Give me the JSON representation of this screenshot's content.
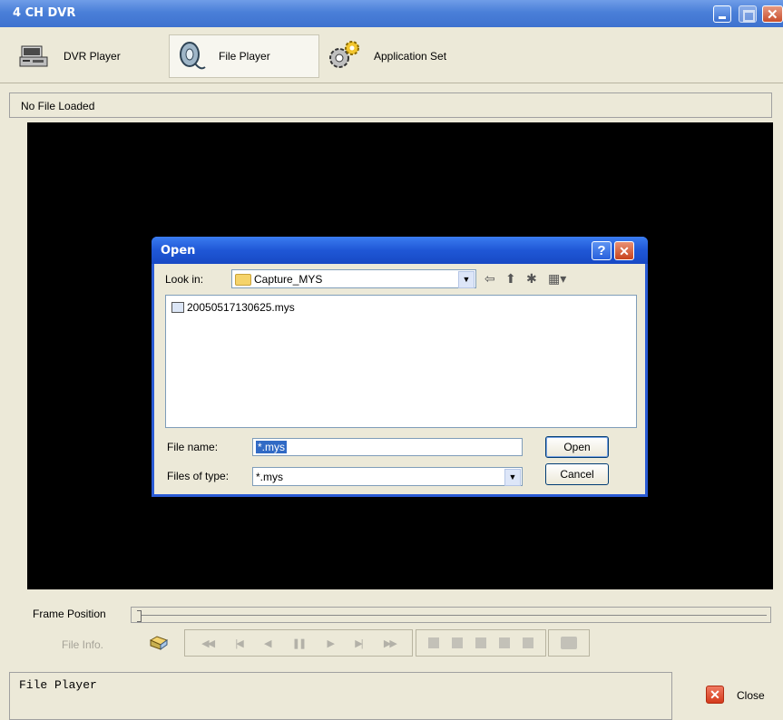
{
  "window": {
    "title": "4 CH DVR"
  },
  "toolbar": {
    "dvr_label": "DVR Player",
    "file_label": "File Player",
    "app_label": "Application Set"
  },
  "status": {
    "text": "No File Loaded"
  },
  "dialog": {
    "title": "Open",
    "help": "?",
    "look_in_label": "Look in:",
    "look_in_value": "Capture_MYS",
    "files": [
      "20050517130625.mys"
    ],
    "file_name_label": "File name:",
    "file_name_value": "*.mys",
    "file_type_label": "Files of type:",
    "file_type_value": "*.mys",
    "open_label": "Open",
    "cancel_label": "Cancel"
  },
  "controls": {
    "frame_position_label": "Frame Position",
    "file_info_label": "File Info.",
    "frame_position": 0
  },
  "bottom": {
    "panel_text": "File Player",
    "close_label": "Close"
  }
}
